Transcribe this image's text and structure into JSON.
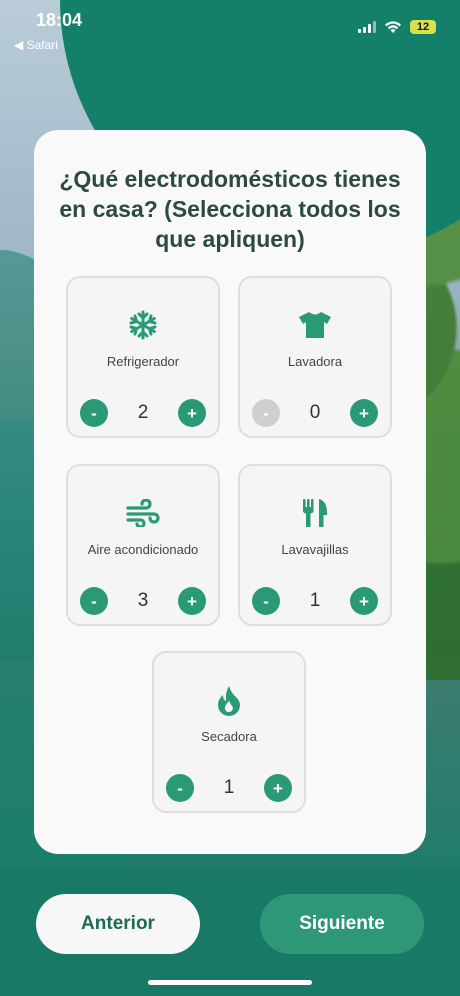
{
  "status_bar": {
    "time": "18:04",
    "back_label": "◀ Safari",
    "battery": "12"
  },
  "question": "¿Qué electrodomésticos tienes en casa? (Selecciona todos los que apliquen)",
  "accent_color": "#2a9a76",
  "appliances": [
    {
      "label": "Refrigerador",
      "icon": "snowflake-icon",
      "count": "2",
      "minus": "-",
      "plus": "+",
      "minus_disabled": false
    },
    {
      "label": "Lavadora",
      "icon": "tshirt-icon",
      "count": "0",
      "minus": "-",
      "plus": "+",
      "minus_disabled": true
    },
    {
      "label": "Aire acondicionado",
      "icon": "wind-icon",
      "count": "3",
      "minus": "-",
      "plus": "+",
      "minus_disabled": false
    },
    {
      "label": "Lavavajillas",
      "icon": "utensils-icon",
      "count": "1",
      "minus": "-",
      "plus": "+",
      "minus_disabled": false
    },
    {
      "label": "Secadora",
      "icon": "flame-icon",
      "count": "1",
      "minus": "-",
      "plus": "+",
      "minus_disabled": false
    }
  ],
  "nav": {
    "prev_label": "Anterior",
    "next_label": "Siguiente"
  }
}
